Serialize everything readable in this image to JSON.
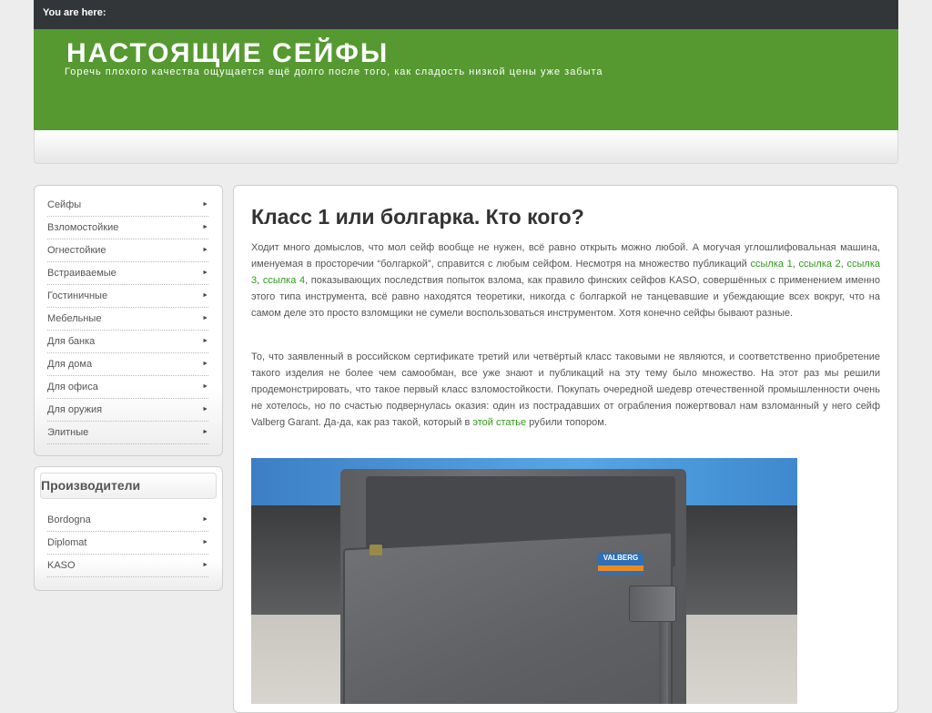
{
  "topbar": {
    "breadcrumb_label": "You are here:"
  },
  "header": {
    "title": "НАСТОЯЩИЕ СЕЙФЫ",
    "description": "Горечь плохого качества ощущается ещё долго после того, как сладость низкой цены уже забыта"
  },
  "sidebar": {
    "categories": [
      {
        "label": "Сейфы"
      },
      {
        "label": "Взломостойкие"
      },
      {
        "label": "Огнестойкие"
      },
      {
        "label": "Встраиваемые"
      },
      {
        "label": "Гостиничные"
      },
      {
        "label": "Мебельные"
      },
      {
        "label": "Для банка"
      },
      {
        "label": "Для дома"
      },
      {
        "label": "Для офиса"
      },
      {
        "label": "Для оружия"
      },
      {
        "label": "Элитные"
      }
    ],
    "manufacturers": {
      "title": "Производители",
      "items": [
        {
          "label": "Bordogna"
        },
        {
          "label": "Diplomat"
        },
        {
          "label": "KASO"
        }
      ]
    }
  },
  "post": {
    "title": "Класс 1 или болгарка. Кто кого?",
    "p1": {
      "before": "Ходит много домыслов, что мол сейф вообще не нужен, всё равно открыть можно любой. А могучая углошлифовальная машина, именуемая в просторечии “болгаркой”, справится с любым сейфом. Несмотря на множество публикаций ",
      "links": [
        "ссылка 1",
        "ссылка 2",
        "ссылка 3",
        "ссылка 4"
      ],
      "link_sep": ", ",
      "after": ", показывающих последствия попыток взлома, как правило финских сейфов KASO, совершённых с применением именно этого типа инструмента, всё равно находятся теоретики, никогда с болгаркой не танцевавшие и убеждающие всех вокруг, что на самом деле это просто взломщики не сумели воспользоваться инструментом. Хотя конечно сейфы бывают разные."
    },
    "p2": {
      "before": "То, что заявленный в российском сертификате третий или четвёртый класс таковыми не являются, и соответственно приобретение такого изделия не более чем самообман, все уже знают и публикаций на эту тему было множество. На этот раз мы решили продемонстрировать, что такое первый класс взломостойкости. Покупать очередной шедевр отечественной промышленности очень не хотелось, но по счастью подвернулась оказия: один из пострадавших от ограбления пожертвовал нам взломанный у него сейф Valberg Garant. Да-да, как раз такой, который в ",
      "link": "этой статье",
      "after": " рубили топором."
    },
    "photo": {
      "brand_plate": "VALBERG"
    }
  },
  "colors": {
    "topbar": "#333638",
    "header_green": "#559930",
    "link_green": "#2d9c16"
  },
  "icons": {
    "menu_arrow": "arrow-right-icon"
  }
}
